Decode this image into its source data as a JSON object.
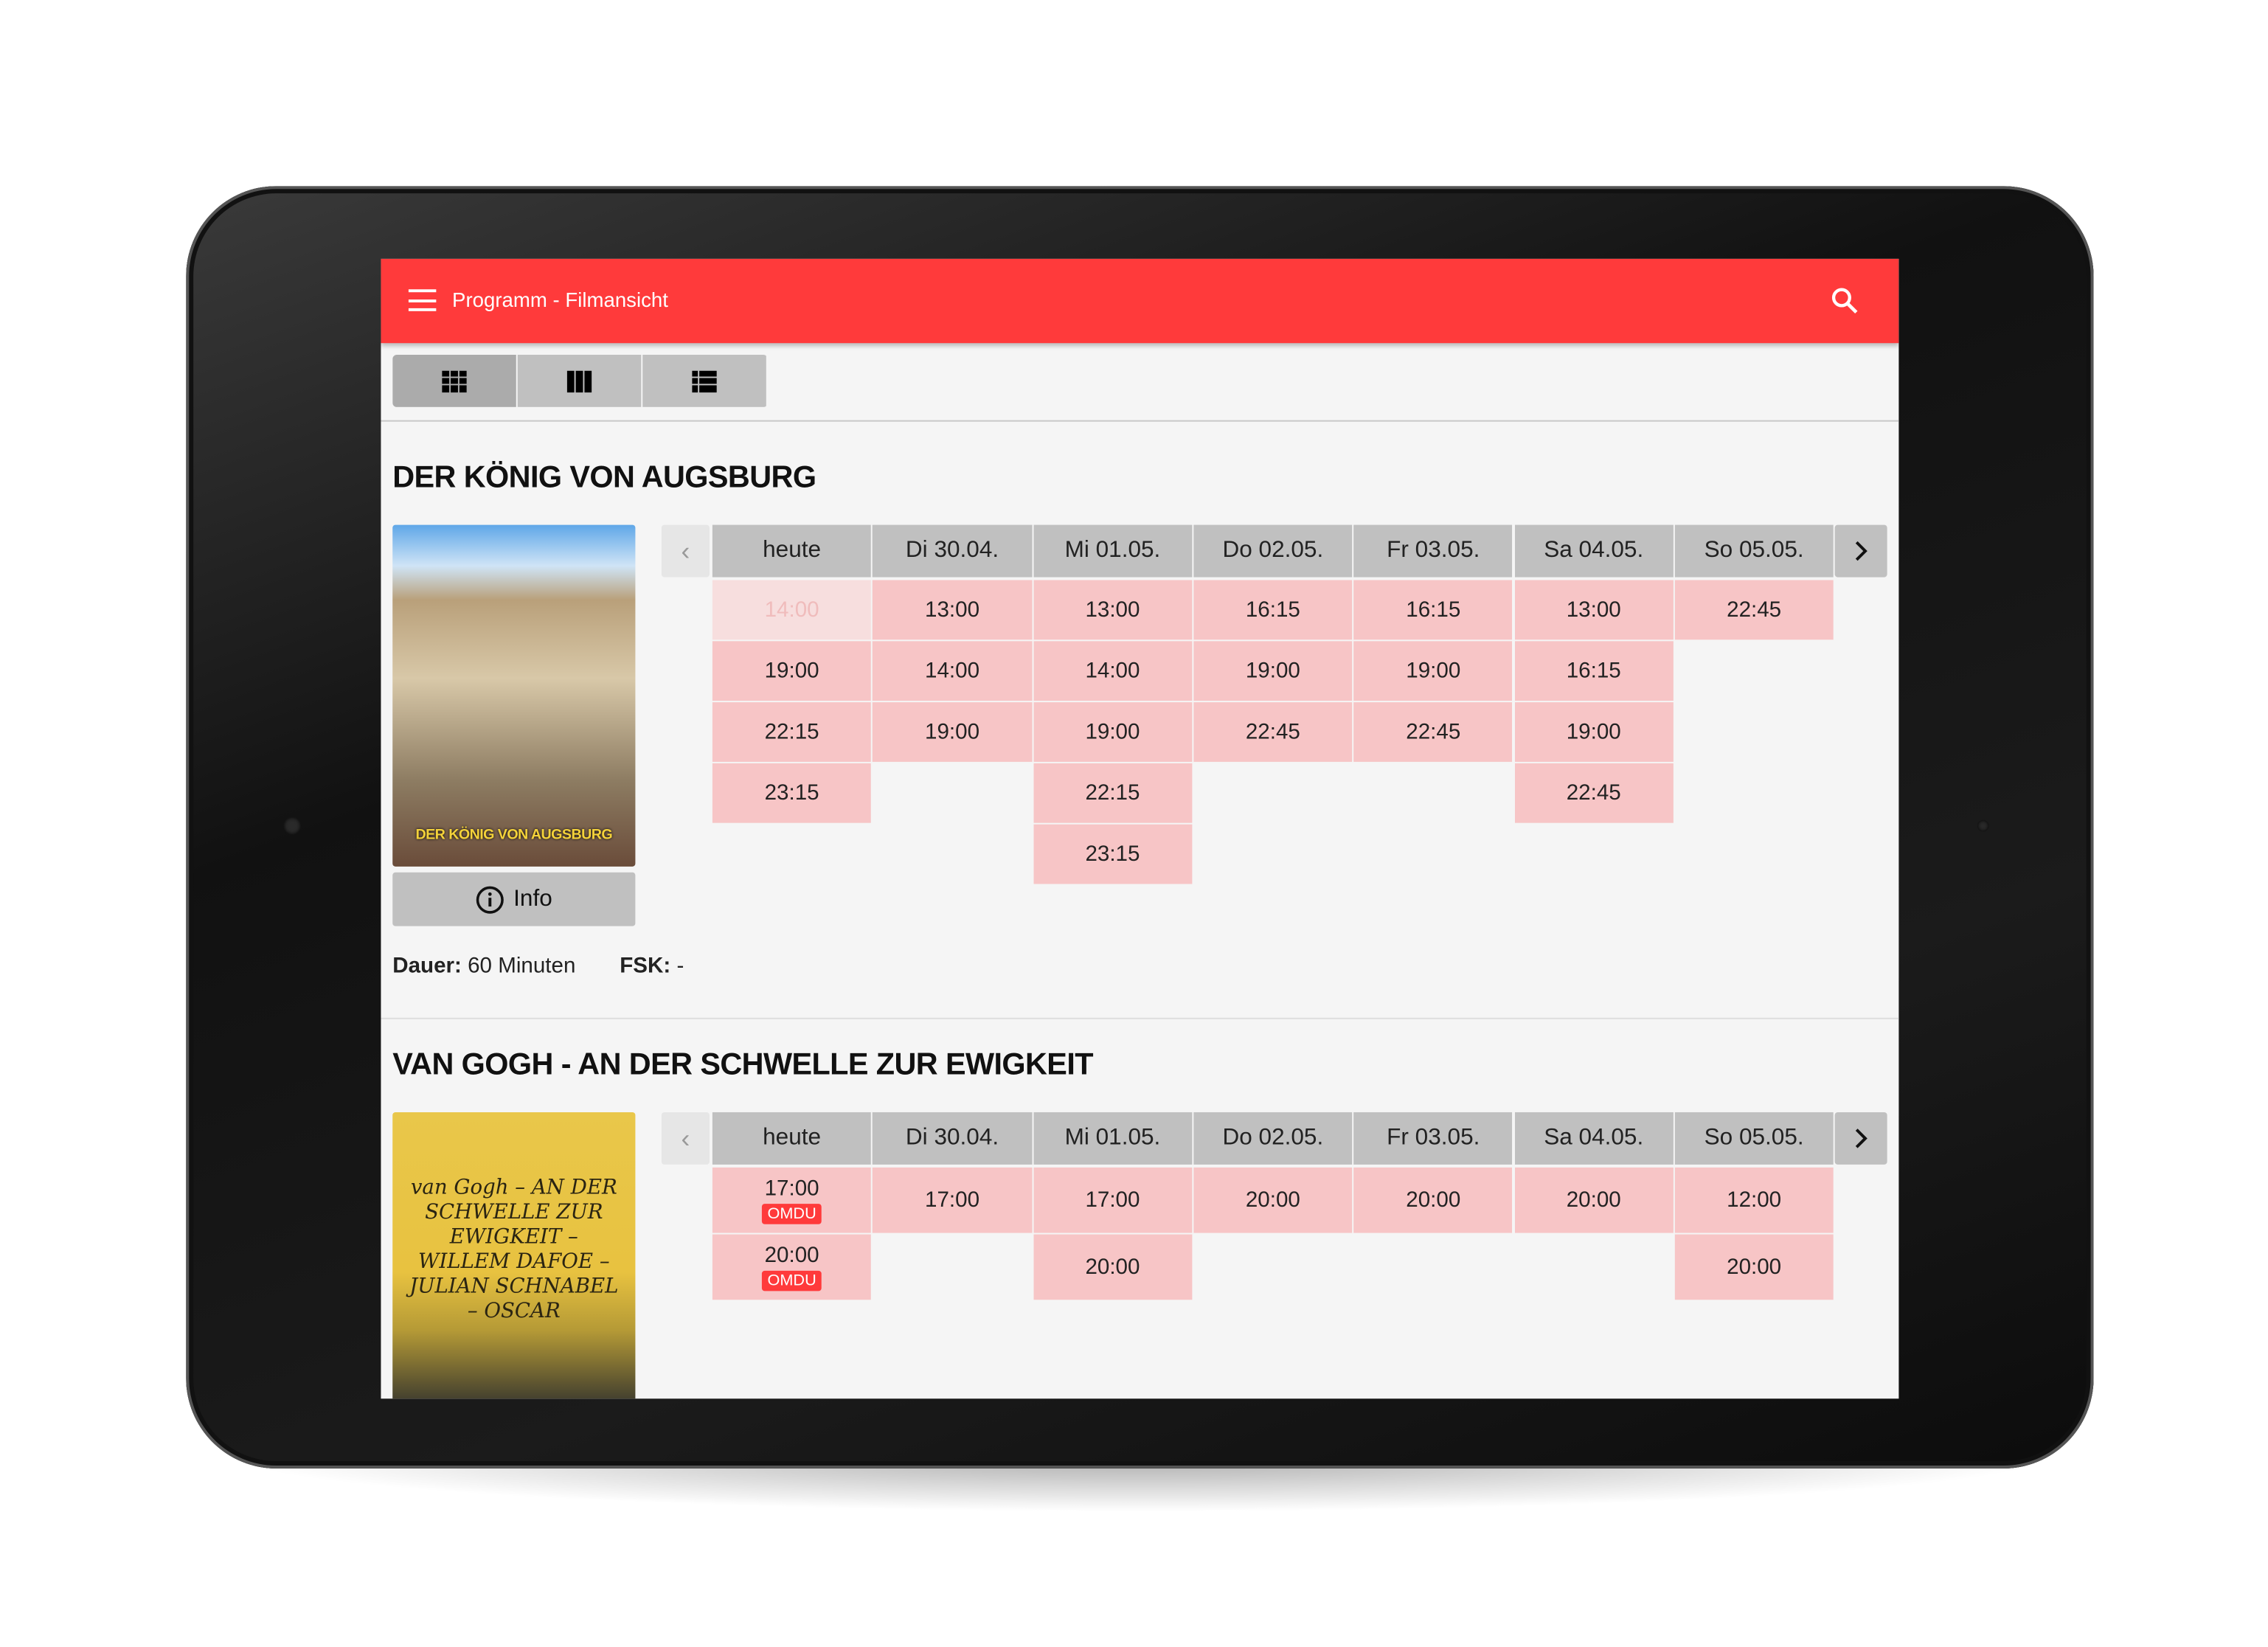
{
  "appbar": {
    "title": "Programm - Filmansicht",
    "menu_icon": "hamburger-menu-icon",
    "search_icon": "search-icon"
  },
  "colors": {
    "brand": "#ff3a3b",
    "slot": "#f7c5c6",
    "header_cell": "#c0c0c0"
  },
  "view_toggle": [
    {
      "icon": "grid-view-icon",
      "active": true
    },
    {
      "icon": "column-view-icon",
      "active": false
    },
    {
      "icon": "list-view-icon",
      "active": false
    }
  ],
  "days": [
    "heute",
    "Di 30.04.",
    "Mi 01.05.",
    "Do 02.05.",
    "Fr 03.05.",
    "Sa 04.05.",
    "So 05.05."
  ],
  "films": [
    {
      "title": "DER KÖNIG VON AUGSBURG",
      "poster_text": "DER KÖNIG VON AUGSBURG",
      "info_label": "Info",
      "duration_label": "Dauer:",
      "duration_value": "60 Minuten",
      "fsk_label": "FSK:",
      "fsk_value": "-",
      "schedule": [
        [
          {
            "time": "14:00",
            "past": true
          },
          {
            "time": "19:00"
          },
          {
            "time": "22:15"
          },
          {
            "time": "23:15"
          }
        ],
        [
          {
            "time": "13:00"
          },
          {
            "time": "14:00"
          },
          {
            "time": "19:00"
          }
        ],
        [
          {
            "time": "13:00"
          },
          {
            "time": "14:00"
          },
          {
            "time": "19:00"
          },
          {
            "time": "22:15"
          },
          {
            "time": "23:15"
          }
        ],
        [
          {
            "time": "16:15"
          },
          {
            "time": "19:00"
          },
          {
            "time": "22:45"
          }
        ],
        [
          {
            "time": "16:15"
          },
          {
            "time": "19:00"
          },
          {
            "time": "22:45"
          }
        ],
        [
          {
            "time": "13:00"
          },
          {
            "time": "16:15"
          },
          {
            "time": "19:00"
          },
          {
            "time": "22:45"
          }
        ],
        [
          {
            "time": "22:45"
          }
        ]
      ]
    },
    {
      "title": "VAN GOGH - AN DER SCHWELLE ZUR EWIGKEIT",
      "poster_text": "van Gogh – AN DER SCHWELLE ZUR EWIGKEIT – WILLEM DAFOE – JULIAN SCHNABEL – OSCAR",
      "schedule": [
        [
          {
            "time": "17:00",
            "badge": "OMDU"
          },
          {
            "time": "20:00",
            "badge": "OMDU"
          }
        ],
        [
          {
            "time": "17:00"
          }
        ],
        [
          {
            "time": "17:00"
          },
          {
            "time": "20:00"
          }
        ],
        [
          {
            "time": "20:00"
          }
        ],
        [
          {
            "time": "20:00"
          }
        ],
        [
          {
            "time": "20:00"
          }
        ],
        [
          {
            "time": "12:00"
          },
          {
            "time": "20:00"
          }
        ]
      ]
    }
  ]
}
